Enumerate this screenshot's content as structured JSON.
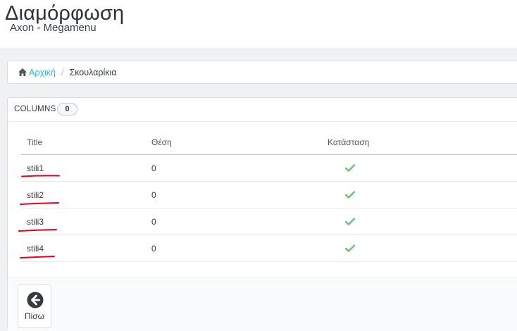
{
  "header": {
    "title": "Διαμόρφωση",
    "subtitle": "Axon - Megamenu"
  },
  "breadcrumb": {
    "home_label": "Αρχική",
    "separator": "/",
    "current": "Σκουλαρίκια"
  },
  "panel": {
    "heading": "COLUMNS",
    "count": "0",
    "columns": {
      "title": "Title",
      "position": "Θέση",
      "status": "Κατάσταση"
    },
    "rows": [
      {
        "title": "stili1",
        "position": "0",
        "status_icon": "check-icon"
      },
      {
        "title": "stili2",
        "position": "0",
        "status_icon": "check-icon"
      },
      {
        "title": "stili3",
        "position": "0",
        "status_icon": "check-icon"
      },
      {
        "title": "stili4",
        "position": "0",
        "status_icon": "check-icon"
      }
    ],
    "back_label": "Πίσω"
  },
  "colors": {
    "link": "#25b9d7",
    "check": "#72c279",
    "annotation": "#e8001c"
  }
}
